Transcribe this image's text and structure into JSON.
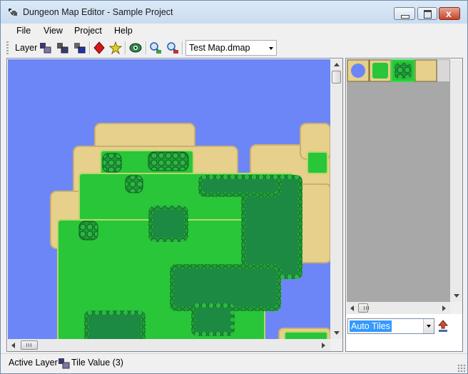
{
  "window": {
    "title": "Dungeon Map Editor - Sample Project",
    "close_glyph": "x"
  },
  "menu": {
    "items": [
      "File",
      "View",
      "Project",
      "Help"
    ]
  },
  "toolbar": {
    "layer_label": "Layer",
    "buttons": [
      "layer-1-icon",
      "layer-2-icon",
      "layer-3-icon",
      "red-gem-icon",
      "star-icon",
      "eye-icon",
      "zoom-in-icon",
      "zoom-out-icon"
    ],
    "map_selected": "Test Map.dmap"
  },
  "tile_panel": {
    "tileset_selected": "Auto Tiles",
    "tiles": [
      "water-tile",
      "grass-tile",
      "bush-tile",
      "sand-tile"
    ]
  },
  "status": {
    "active_layer_label": "Active Layer",
    "tile_value": "Tile Value (3)"
  },
  "colors": {
    "water": "#6c86f7",
    "sand": "#e6d08c",
    "grass": "#28c638",
    "dark_grass": "#1d8a44",
    "bush": "#23a53a"
  }
}
